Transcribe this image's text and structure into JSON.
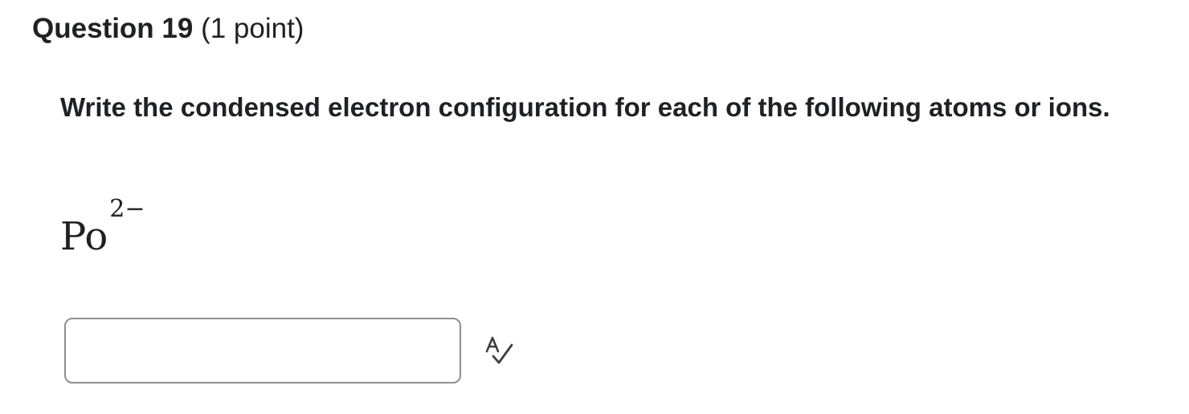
{
  "question": {
    "number_label": "Question 19",
    "points_label": "(1 point)",
    "prompt": "Write the condensed electron configuration for each of the following atoms or ions.",
    "formula": {
      "symbol": "Po",
      "charge": "2−"
    },
    "answer": {
      "value": "",
      "placeholder": ""
    },
    "spellcheck_icon": "spellcheck-icon"
  }
}
